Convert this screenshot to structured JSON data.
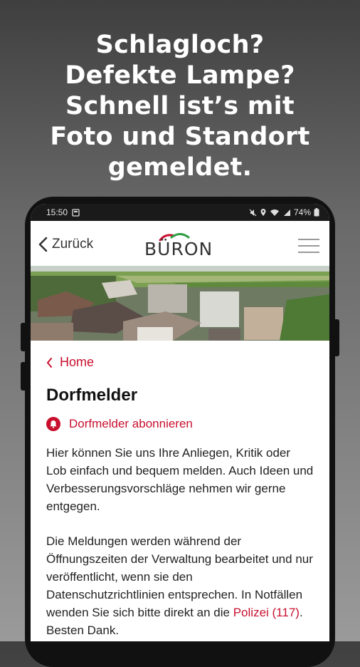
{
  "promo": {
    "line1": "Schlagloch?",
    "line2": "Defekte Lampe?",
    "line3": "Schnell ist’s mit",
    "line4": "Foto und Standort",
    "line5": "gemeldet."
  },
  "statusbar": {
    "time": "15:50",
    "battery": "74%"
  },
  "appbar": {
    "back_label": "Zurück",
    "logo_text": "BÜRON"
  },
  "breadcrumb": {
    "home_label": "Home"
  },
  "page": {
    "title": "Dorfmelder",
    "subscribe_label": "Dorfmelder abonnieren",
    "para1": "Hier können Sie uns Ihre Anliegen, Kritik oder Lob einfach und bequem melden. Auch Ideen und Verbesserungsvorschläge nehmen wir gerne entgegen.",
    "para2_before": "Die Meldungen werden während der Öffnungszeiten der Verwaltung bearbeitet und nur veröffentlicht, wenn sie den Datenschutzrichtlinien entsprechen. In Notfällen wenden Sie sich bitte direkt an die ",
    "police_link": "Polizei (117)",
    "para2_after": ". Besten Dank."
  },
  "colors": {
    "accent": "#c8102e",
    "logo_green": "#2e9e44"
  }
}
